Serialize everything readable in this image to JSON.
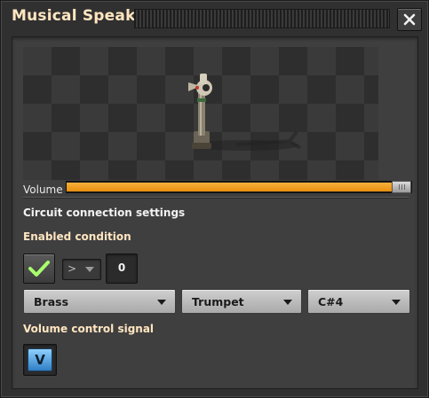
{
  "window": {
    "title": "Musical Speaker",
    "close_icon": "close-icon"
  },
  "volume": {
    "label": "Volume",
    "value": 1.0,
    "accent": "#f0a020"
  },
  "circuit": {
    "section_title": "Circuit connection settings",
    "enabled_condition_label": "Enabled condition",
    "condition_signal_icon": "check-icon",
    "comparator": ">",
    "constant": "0",
    "instrument": "Brass",
    "note_instrument": "Trumpet",
    "note": "C#4",
    "volume_signal_label": "Volume control signal",
    "volume_signal": "V"
  },
  "colors": {
    "heading": "#ffe6c0",
    "check": "#a8ff6e",
    "signal_blue": "#4aa0e8"
  }
}
